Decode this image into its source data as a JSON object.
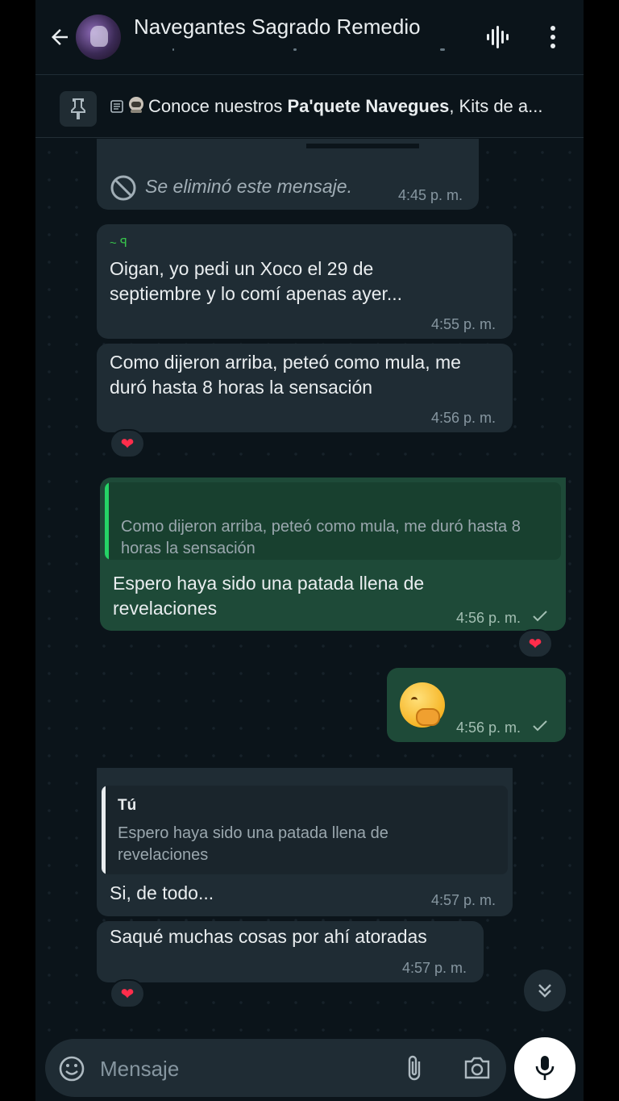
{
  "header": {
    "title": "Navegantes Sagrado Remedio",
    "back_icon": "arrow-left-icon",
    "voice_icon": "voice-chat-icon",
    "menu_icon": "more-vert-icon"
  },
  "pinned": {
    "text_before": "Conoce nuestros ",
    "text_bold": "Pa'quete Navegues",
    "text_after": ", Kits de a..."
  },
  "messages": {
    "m1": {
      "deleted_text": "Se eliminó este mensaje.",
      "time": "4:45 p. m."
    },
    "m2": {
      "sender": "~ ꟼ",
      "text": "Oigan, yo pedi un Xoco el 29 de septiembre y lo comí apenas ayer...",
      "time": "4:55 p. m."
    },
    "m3": {
      "text": "Como dijeron arriba, peteó como mula, me duró hasta 8 horas la sensación",
      "time": "4:56 p. m.",
      "reaction": "❤"
    },
    "m4": {
      "quote_text": "Como dijeron arriba, peteó como mula, me duró hasta 8 horas la sensación",
      "text": "Espero haya sido una patada llena de revelaciones",
      "time": "4:56 p. m.",
      "reaction": "❤"
    },
    "m5": {
      "emoji": "face-with-hand-over-mouth",
      "time": "4:56 p. m."
    },
    "m6": {
      "quote_name": "Tú",
      "quote_text": "Espero haya sido una patada llena de revelaciones",
      "text": "Si, de todo...",
      "time": "4:57 p. m."
    },
    "m7": {
      "text": "Saqué muchas cosas por ahí atoradas",
      "time": "4:57 p. m.",
      "reaction": "❤"
    }
  },
  "input": {
    "placeholder": "Mensaje"
  },
  "colors": {
    "background": "#0b141a",
    "incoming": "#1f2c34",
    "outgoing": "#1e4a38",
    "quote_bar_in": "#e9edef",
    "quote_bar_out": "#25d366"
  }
}
